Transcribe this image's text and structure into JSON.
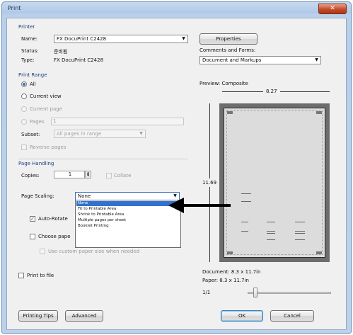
{
  "window": {
    "title": "Print",
    "close_glyph": "✕"
  },
  "printer": {
    "group_label": "Printer",
    "name_label": "Name:",
    "name_value": "FX DocuPrint C2428",
    "status_label": "Status:",
    "status_value": "준비됨",
    "type_label": "Type:",
    "type_value": "FX DocuPrint C2428",
    "properties_button": "Properties",
    "comments_label": "Comments and Forms:",
    "comments_value": "Document and Markups"
  },
  "print_range": {
    "group_label": "Print Range",
    "all": "All",
    "current_view": "Current view",
    "current_page": "Current page",
    "pages": "Pages",
    "pages_value": "1",
    "subset_label": "Subset:",
    "subset_value": "All pages in range",
    "reverse_pages": "Reverse pages"
  },
  "page_handling": {
    "group_label": "Page Handling",
    "copies_label": "Copies:",
    "copies_value": "1",
    "collate": "Collate",
    "scaling_label": "Page Scaling:",
    "scaling_value": "None",
    "auto_rotate": "Auto-Rotate",
    "choose_paper": "Choose pape",
    "custom_paper": "Use custom paper size when needed",
    "scaling_options": [
      "None",
      "Fit to Printable Area",
      "Shrink to Printable Area",
      "Multiple pages per sheet",
      "Booklet Printing"
    ]
  },
  "print_to_file": "Print to file",
  "preview": {
    "label": "Preview: Composite",
    "width_value": "8.27",
    "height_value": "11.69",
    "document_size": "Document: 8.3 x 11.7in",
    "paper_size": "Paper: 8.3 x 11.7in",
    "page_counter": "1/1"
  },
  "footer": {
    "printing_tips": "Printing Tips",
    "advanced": "Advanced",
    "ok": "OK",
    "cancel": "Cancel"
  }
}
